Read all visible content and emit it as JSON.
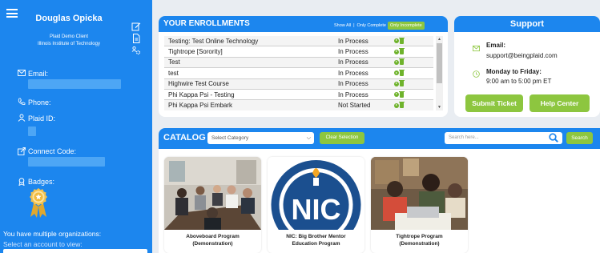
{
  "sidebar": {
    "user_name": "Douglas Opicka",
    "client": "Plaid Demo Client",
    "school": "Illinois Institute of Technology",
    "fields": {
      "email_label": "Email:",
      "phone_label": "Phone:",
      "plaid_id_label": "Plaid ID:",
      "connect_code_label": "Connect Code:",
      "badges_label": "Badges:"
    },
    "orgs_title": "You have multiple organizations:",
    "orgs_subtitle": "Select an account to view:"
  },
  "enrollments": {
    "title": "YOUR ENROLLMENTS",
    "filters": {
      "show_all": "Show All",
      "sep": "|",
      "only_complete": "Only Complete",
      "only_incomplete": "Only Incomplete"
    },
    "rows": [
      {
        "name": "Testing: Test Online Technology",
        "status": "In Process"
      },
      {
        "name": "Tightrope [Sorority]",
        "status": "In Process"
      },
      {
        "name": "Test",
        "status": "In Process"
      },
      {
        "name": "test",
        "status": "In Process"
      },
      {
        "name": "Highwire Test Course",
        "status": "In Process"
      },
      {
        "name": "Phi Kappa Psi - Testing",
        "status": "In Process"
      },
      {
        "name": "Phi Kappa Psi Embark",
        "status": "Not Started"
      }
    ]
  },
  "support": {
    "title": "Support",
    "email_label": "Email:",
    "email_value": "support@beingplaid.com",
    "hours_label": "Monday to Friday:",
    "hours_value": "9:00 am to 5:00 pm ET",
    "submit_ticket": "Submit Ticket",
    "help_center": "Help Center"
  },
  "catalog": {
    "title": "CATALOG",
    "category_placeholder": "Select Category",
    "clear_selection": "Clear Selection",
    "search_placeholder": "Search here...",
    "search_button": "Search",
    "items": [
      {
        "title_line1": "Aboveboard Program",
        "title_line2": "(Demonstration)"
      },
      {
        "title_line1": "NIC: Big Brother Mentor",
        "title_line2": "Education Program",
        "logo_text": "NIC"
      },
      {
        "title_line1": "Tightrope Program",
        "title_line2": "(Demonstration)"
      }
    ]
  },
  "colors": {
    "primary_blue": "#1c86ee",
    "accent_green": "#8dc63f",
    "background": "#e9edf2"
  }
}
